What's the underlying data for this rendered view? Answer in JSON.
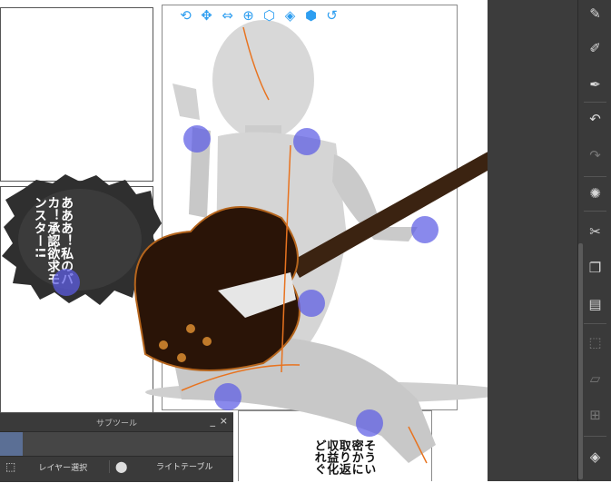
{
  "canvas": {
    "speech_bubble_text": [
      "あああ！",
      "私のバカ！",
      "承認欲求",
      "モンスター!!"
    ],
    "bottom_text": [
      "そうい",
      "密かに",
      "取り返",
      "収益化",
      "どれぐ"
    ]
  },
  "object_toolbar": {
    "icons": [
      "camera-rotate-icon",
      "camera-pan-icon",
      "camera-dolly-icon",
      "move-plane-icon",
      "rotate-model-icon",
      "rotate-axis-icon",
      "move-model-icon",
      "reset-icon"
    ]
  },
  "right_toolbar": {
    "icons": [
      "pen-icon",
      "pencil-icon",
      "brush-icon",
      "undo-icon",
      "redo-icon",
      "loading-icon",
      "cut-icon",
      "copy-icon",
      "paste-icon",
      "transform-icon",
      "perspective-icon",
      "mesh-icon",
      "fill-icon"
    ]
  },
  "subtool_panel": {
    "title": "サブツール",
    "minimize": "_",
    "close": "×",
    "tools": [
      {
        "label": "レイヤー選択",
        "icon": "layer-select-icon"
      },
      {
        "label": "",
        "icon": "pen-nib-icon"
      },
      {
        "label": "ライトテーブル",
        "icon": ""
      }
    ]
  },
  "colors": {
    "gizmo": "#2e9ef0",
    "handle": "#5c5ce4",
    "dark_ui": "#3a3a3a",
    "tab_selected": "#5b6f95",
    "guitar_body": "#2a1407",
    "outline": "#e8731f"
  }
}
